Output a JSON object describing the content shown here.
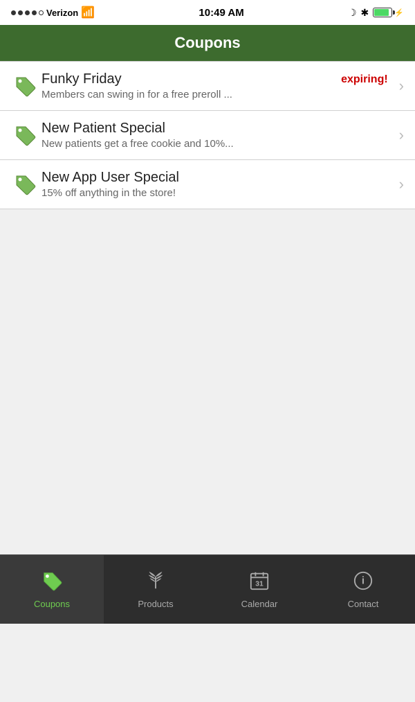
{
  "statusBar": {
    "carrier": "Verizon",
    "time": "10:49 AM",
    "batteryPercent": 85
  },
  "header": {
    "title": "Coupons"
  },
  "coupons": [
    {
      "id": 1,
      "title": "Funky Friday",
      "description": "Members can swing in for a free preroll ...",
      "expiring": true,
      "expiringLabel": "expiring!"
    },
    {
      "id": 2,
      "title": "New Patient Special",
      "description": "New patients get a free cookie and 10%...",
      "expiring": false,
      "expiringLabel": ""
    },
    {
      "id": 3,
      "title": "New App User Special",
      "description": "15% off anything in the store!",
      "expiring": false,
      "expiringLabel": ""
    }
  ],
  "tabs": [
    {
      "id": "coupons",
      "label": "Coupons",
      "active": true
    },
    {
      "id": "products",
      "label": "Products",
      "active": false
    },
    {
      "id": "calendar",
      "label": "Calendar",
      "active": false
    },
    {
      "id": "contact",
      "label": "Contact",
      "active": false
    }
  ]
}
